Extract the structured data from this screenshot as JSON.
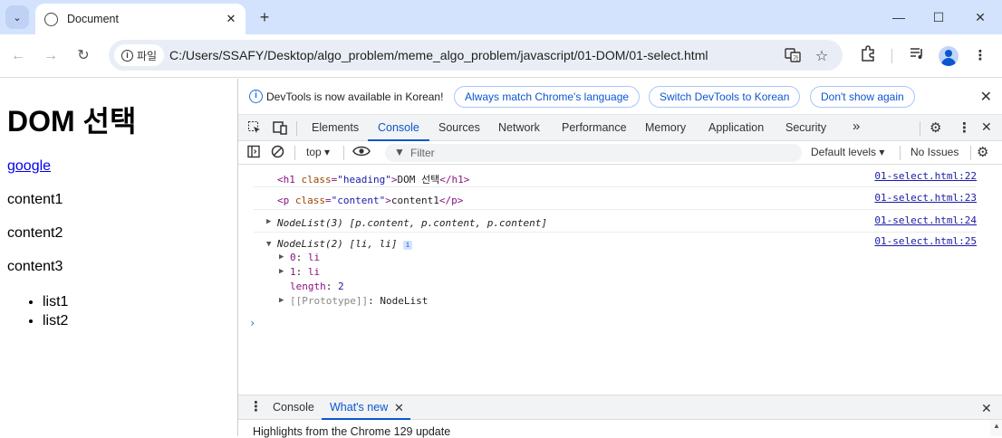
{
  "browser": {
    "tab": {
      "title": "Document",
      "close": "✕"
    },
    "new_tab": "+",
    "window_controls": {
      "minimize": "—",
      "maximize": "☐",
      "close": "✕"
    },
    "nav": {
      "back": "←",
      "forward": "→",
      "reload": "↻"
    },
    "address": {
      "chip_label": "파일",
      "url": "C:/Users/SSAFY/Desktop/algo_problem/meme_algo_problem/javascript/01-DOM/01-select.html"
    },
    "icons": [
      "translate-icon",
      "bookmark-star-icon",
      "extensions-icon",
      "media-queue-icon",
      "profile-avatar-icon",
      "kebab-menu-icon"
    ]
  },
  "page": {
    "heading": "DOM 선택",
    "link": "google",
    "paragraphs": [
      "content1",
      "content2",
      "content3"
    ],
    "list": [
      "list1",
      "list2"
    ]
  },
  "devtools": {
    "infobar": {
      "message": "DevTools is now available in Korean!",
      "buttons": [
        "Always match Chrome's language",
        "Switch DevTools to Korean",
        "Don't show again"
      ]
    },
    "tabs": [
      "Elements",
      "Console",
      "Sources",
      "Network",
      "Performance",
      "Memory",
      "Application",
      "Security"
    ],
    "active_tab": "Console",
    "more_tabs": "»",
    "console_toolbar": {
      "context": "top",
      "filter_placeholder": "Filter",
      "levels": "Default levels",
      "issues": "No Issues"
    },
    "console": {
      "rows": [
        {
          "tag_open": "<h1 ",
          "attr_name": "class",
          "attr_val": "\"heading\"",
          "text": "DOM 선택",
          "tag_close": "</h1>",
          "source": "01-select.html:22"
        },
        {
          "tag_open": "<p ",
          "attr_name": "class",
          "attr_val": "\"content\"",
          "text": "content1",
          "tag_close": "</p>",
          "source": "01-select.html:23"
        }
      ],
      "nodelist1": {
        "label": "NodeList(3)",
        "items": "[p.content, p.content, p.content]",
        "source": "01-select.html:24"
      },
      "nodelist2": {
        "label": "NodeList(2)",
        "items": "[li, li]",
        "source": "01-select.html:25",
        "entries": [
          {
            "key": "0",
            "value": "li"
          },
          {
            "key": "1",
            "value": "li"
          }
        ],
        "length_key": "length",
        "length_val": "2",
        "proto_key": "[[Prototype]]",
        "proto_val": "NodeList"
      }
    },
    "drawer": {
      "tabs": [
        "Console",
        "What's new"
      ],
      "active_tab": "What's new",
      "highlight": "Highlights from the Chrome 129 update"
    }
  }
}
